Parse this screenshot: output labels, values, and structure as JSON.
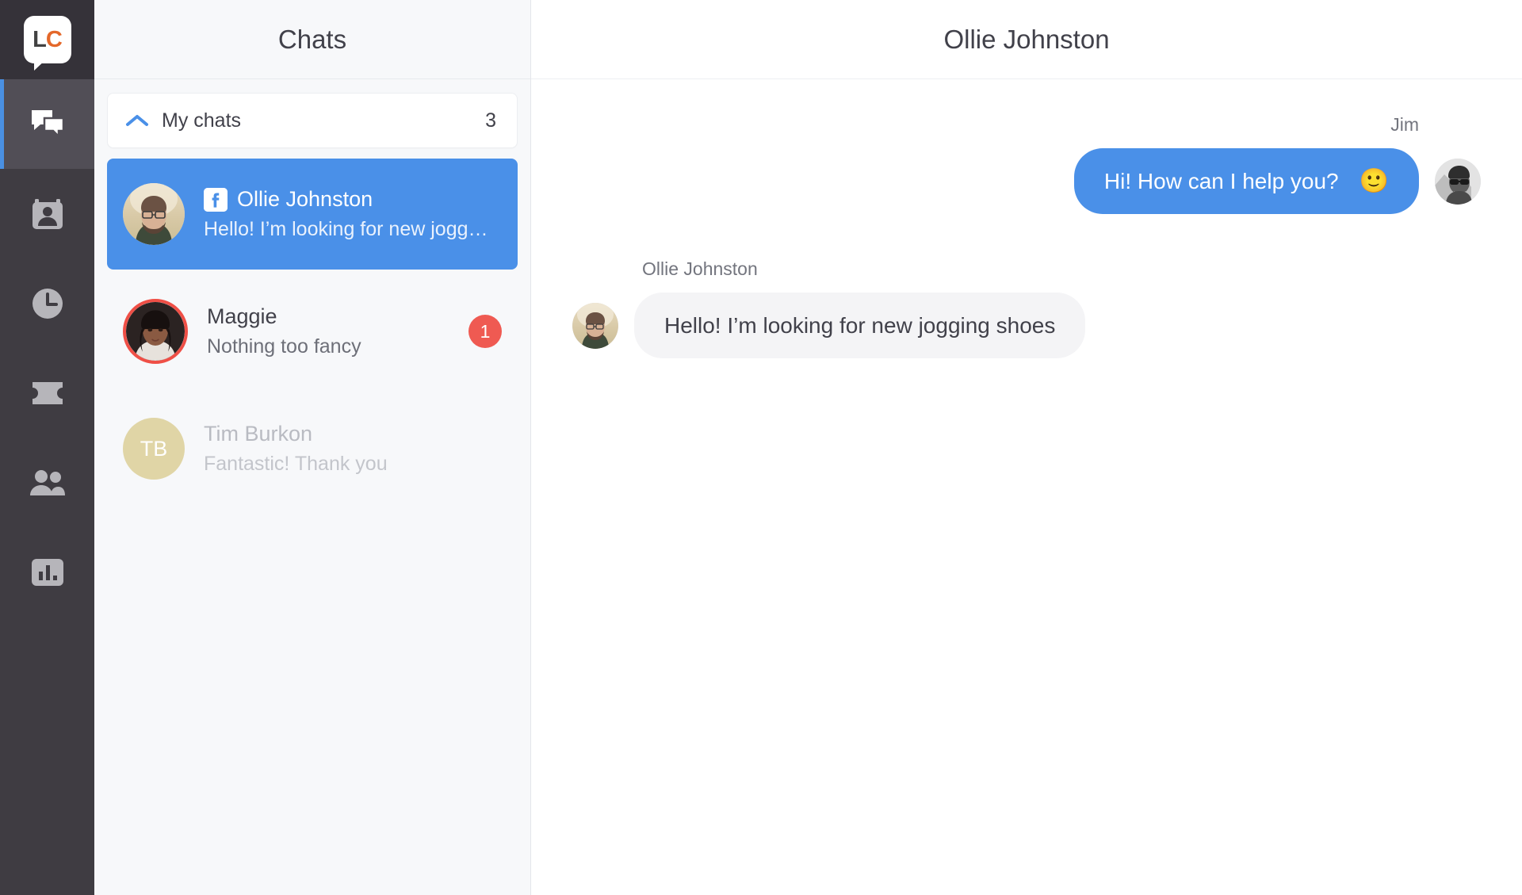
{
  "app": {
    "logo_text_left": "L",
    "logo_text_right": "C",
    "logo_name": "livechat-logo"
  },
  "nav": {
    "items": [
      {
        "icon": "chats-icon",
        "label": "Chats",
        "active": true
      },
      {
        "icon": "archives-contact-card-icon",
        "label": "Archives",
        "active": false
      },
      {
        "icon": "clock-history-icon",
        "label": "History",
        "active": false
      },
      {
        "icon": "ticket-icon",
        "label": "Tickets",
        "active": false
      },
      {
        "icon": "team-people-icon",
        "label": "Team",
        "active": false
      },
      {
        "icon": "bar-chart-reports-icon",
        "label": "Reports",
        "active": false
      }
    ]
  },
  "chat_panel": {
    "title": "Chats",
    "group": {
      "label": "My chats",
      "count": "3",
      "chevron_icon": "chevron-up-icon",
      "expanded": true
    },
    "rows": [
      {
        "name": "Ollie Johnston",
        "preview": "Hello! I’m looking for new jogg…",
        "selected": true,
        "muted": false,
        "channel_icon": "facebook-icon",
        "avatar_type": "photo",
        "avatar_kind": "ollie",
        "avatar_ring": "none",
        "unread": ""
      },
      {
        "name": "Maggie",
        "preview": "Nothing too fancy",
        "selected": false,
        "muted": false,
        "channel_icon": "",
        "avatar_type": "photo",
        "avatar_kind": "maggie",
        "avatar_ring": "red",
        "unread": "1"
      },
      {
        "name": "Tim Burkon",
        "preview": "Fantastic! Thank you",
        "selected": false,
        "muted": true,
        "channel_icon": "",
        "avatar_type": "initials",
        "avatar_kind": "tim",
        "avatar_initials": "TB",
        "avatar_ring": "none",
        "unread": ""
      }
    ]
  },
  "conversation": {
    "title": "Ollie Johnston",
    "messages": [
      {
        "author": "Jim",
        "text": "Hi! How can I help you?",
        "emoji": "🙂",
        "direction": "outgoing",
        "avatar_kind": "jim"
      },
      {
        "author": "Ollie Johnston",
        "text": "Hello! I’m looking for new jogging shoes",
        "emoji": "",
        "direction": "incoming",
        "avatar_kind": "ollie"
      }
    ]
  },
  "colors": {
    "accent_blue": "#4a90e8",
    "nav_dark": "#3f3c42",
    "nav_active": "#514e56",
    "badge_red": "#ef5a52",
    "ring_red": "#ef4f46",
    "logo_orange": "#e4682a",
    "panel_bg": "#f7f8fa",
    "initials_bg": "#e0d5a6"
  }
}
